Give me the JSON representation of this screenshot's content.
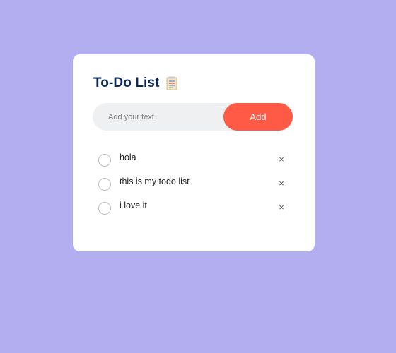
{
  "card": {
    "title": "To-Do List",
    "title_icon": "notepad-icon"
  },
  "input": {
    "value": "",
    "placeholder": "Add your text"
  },
  "add_button": {
    "label": "Add"
  },
  "todos": [
    {
      "text": "hola",
      "checked": false,
      "delete_icon": "×"
    },
    {
      "text": "this is my todo list",
      "checked": false,
      "delete_icon": "×"
    },
    {
      "text": "i love it",
      "checked": false,
      "delete_icon": "×"
    }
  ],
  "colors": {
    "page_background": "#b3aef0",
    "card_background": "#ffffff",
    "title": "#0b2a5a",
    "accent": "#ff5a45",
    "input_background": "#eef0f2"
  }
}
